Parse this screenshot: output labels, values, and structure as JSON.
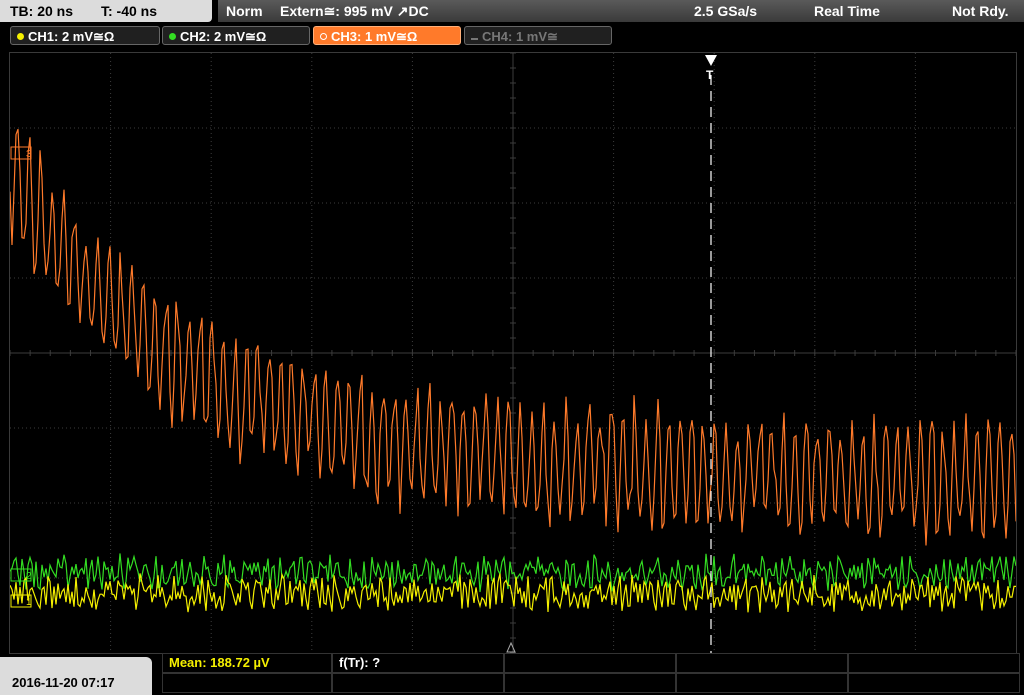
{
  "header": {
    "timebase": "TB: 20 ns",
    "trigger_time": "T: -40 ns",
    "trigger_mode": "Norm",
    "trigger_source": "Extern≅: 995 mV ↗DC",
    "sample_rate": "2.5 GSa/s",
    "acq_mode": "Real Time",
    "status": "Not Rdy."
  },
  "channels": [
    {
      "label": "CH1: 2 mV≅Ω",
      "color": "#f5f000",
      "active": true
    },
    {
      "label": "CH2: 2 mV≅Ω",
      "color": "#33dd22",
      "active": true
    },
    {
      "label": "CH3: 1 mV≅Ω",
      "color": "#ff7a2a",
      "active": true,
      "selected": true
    },
    {
      "label": "CH4: 1 mV≅",
      "color": "#888888",
      "active": false
    }
  ],
  "trigger_marker": "T",
  "level_markers": {
    "ch3": "3",
    "ch2": "2",
    "ch1": "1"
  },
  "footer": {
    "datetime": "2016-11-20 07:17",
    "mean": "Mean: 188.72 µV",
    "freq": "f(Tr): ?"
  },
  "colors": {
    "ch1": "#f5f000",
    "ch2": "#33dd22",
    "ch3": "#ff7a2a",
    "grid": "#3c3c3c",
    "trigger_line": "#ffffff"
  },
  "icons": {
    "channel_dot": "circle-icon",
    "trigger": "trigger-arrow-icon",
    "ground": "ground-triangle-icon"
  }
}
